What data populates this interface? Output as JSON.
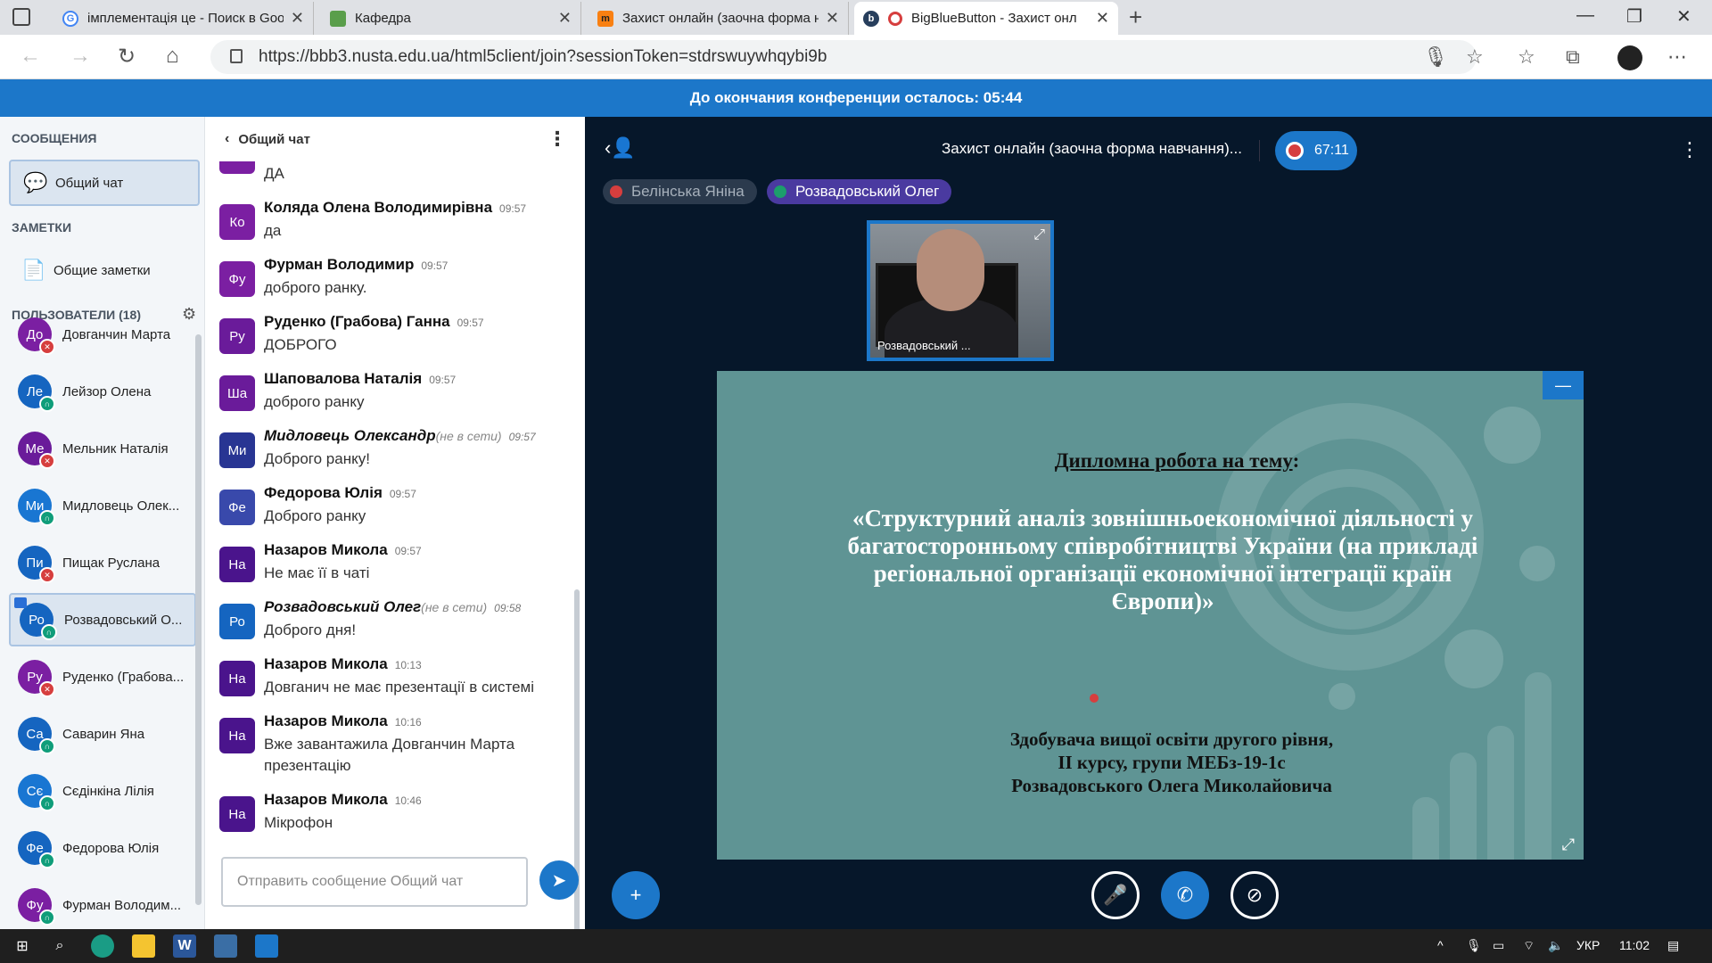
{
  "browser": {
    "tabs": [
      {
        "title": "імплементація це - Поиск в Goo",
        "icon": "google-icon",
        "active": false
      },
      {
        "title": "Кафедра",
        "icon": "image-icon",
        "active": false
      },
      {
        "title": "Захист онлайн (заочна форма н",
        "icon": "moodle-icon",
        "active": false
      },
      {
        "title": "BigBlueButton - Захист онл",
        "icon": "bbb-icon",
        "active": true
      }
    ],
    "url": "https://bbb3.nusta.edu.ua/html5client/join?sessionToken=stdrswuywhqybi9b"
  },
  "banner": {
    "text": "До окончания конференции осталось: 05:44"
  },
  "sidebar": {
    "messages_title": "СООБЩЕНИЯ",
    "public_chat": "Общий чат",
    "notes_title": "ЗАМЕТКИ",
    "shared_notes": "Общие заметки",
    "users_title": "ПОЛЬЗОВАТЕЛИ (18)",
    "users": [
      {
        "initials": "До",
        "name": "Довганчин Марта",
        "color": "#7b1fa2",
        "status": "muted"
      },
      {
        "initials": "Ле",
        "name": "Лейзор Олена",
        "color": "#1565c0",
        "status": "listen"
      },
      {
        "initials": "Ме",
        "name": "Мельник Наталія",
        "color": "#6a1b9a",
        "status": "muted"
      },
      {
        "initials": "Ми",
        "name": "Мидловець Олек...",
        "color": "#1976d2",
        "status": "listen"
      },
      {
        "initials": "Пи",
        "name": "Пищак Руслана",
        "color": "#1565c0",
        "status": "muted"
      },
      {
        "initials": "Ро",
        "name": "Розвадовський О...",
        "color": "#1565c0",
        "status": "listen"
      },
      {
        "initials": "Ру",
        "name": "Руденко (Грабова...",
        "color": "#7b1fa2",
        "status": "muted"
      },
      {
        "initials": "Са",
        "name": "Саварин Яна",
        "color": "#1565c0",
        "status": "listen"
      },
      {
        "initials": "Сє",
        "name": "Сєдінкіна Лілія",
        "color": "#1976d2",
        "status": "listen"
      },
      {
        "initials": "Фе",
        "name": "Федорова Юлія",
        "color": "#1565c0",
        "status": "listen"
      },
      {
        "initials": "Фу",
        "name": "Фурман Володим...",
        "color": "#7b1fa2",
        "status": "listen"
      }
    ]
  },
  "chat": {
    "title": "Общий чат",
    "top_partial": "ДА",
    "messages": [
      {
        "initials": "Ко",
        "color": "#7b1fa2",
        "name": "Коляда Олена Володимирівна",
        "offline": "",
        "time": "09:57",
        "text": "да"
      },
      {
        "initials": "Фу",
        "color": "#7b1fa2",
        "name": "Фурман Володимир",
        "offline": "",
        "time": "09:57",
        "text": "доброго ранку."
      },
      {
        "initials": "Ру",
        "color": "#6a1b9a",
        "name": "Руденко (Грабова) Ганна",
        "offline": "",
        "time": "09:57",
        "text": "ДОБРОГО"
      },
      {
        "initials": "Ша",
        "color": "#6a1b9a",
        "name": "Шаповалова Наталія",
        "offline": "",
        "time": "09:57",
        "text": "доброго ранку"
      },
      {
        "initials": "Ми",
        "color": "#283593",
        "name": "Мидловець Олександр",
        "offline": "(не в сети)",
        "time": "09:57",
        "text": "Доброго ранку!"
      },
      {
        "initials": "Фе",
        "color": "#3949ab",
        "name": "Федорова Юлія",
        "offline": "",
        "time": "09:57",
        "text": "Доброго ранку"
      },
      {
        "initials": "На",
        "color": "#4a148c",
        "name": "Назаров Микола",
        "offline": "",
        "time": "09:57",
        "text": "Не має її в чаті"
      },
      {
        "initials": "Ро",
        "color": "#1565c0",
        "name": "Розвадовський Олег",
        "offline": "(не в сети)",
        "time": "09:58",
        "text": "Доброго дня!"
      },
      {
        "initials": "На",
        "color": "#4a148c",
        "name": "Назаров Микола",
        "offline": "",
        "time": "10:13",
        "text": "Довганич не має презентації в системі"
      },
      {
        "initials": "На",
        "color": "#4a148c",
        "name": "Назаров Микола",
        "offline": "",
        "time": "10:16",
        "text": "Вже завантажила Довганчин Марта презентацію"
      },
      {
        "initials": "На",
        "color": "#4a148c",
        "name": "Назаров Микола",
        "offline": "",
        "time": "10:46",
        "text": "Мікрофон"
      }
    ],
    "input_placeholder": "Отправить сообщение Общий чат"
  },
  "main": {
    "title": "Захист онлайн (заочна форма навчання)...",
    "record_time": "67:11",
    "talkers": [
      {
        "name": "Белінська Яніна",
        "state": "muted"
      },
      {
        "name": "Розвадовський Олег",
        "state": "talking"
      }
    ],
    "webcam_caption": "Розвадовський ...",
    "slide": {
      "heading": "Дипломна робота на тему",
      "colon": ":",
      "topic": "«Структурний аналіз зовнішньоекономічної діяльності у багатосторонньому співробітництві України (на прикладі регіональної організації економічної інтеграції країн Європи)»",
      "author_line1": "Здобувача вищої освіти другого рівня,",
      "author_line2": "II курсу, групи МЕБз-19-1с",
      "author_line3": "Розвадовського Олега Миколайовича"
    }
  },
  "taskbar": {
    "lang": "УКР",
    "clock": "11:02"
  }
}
